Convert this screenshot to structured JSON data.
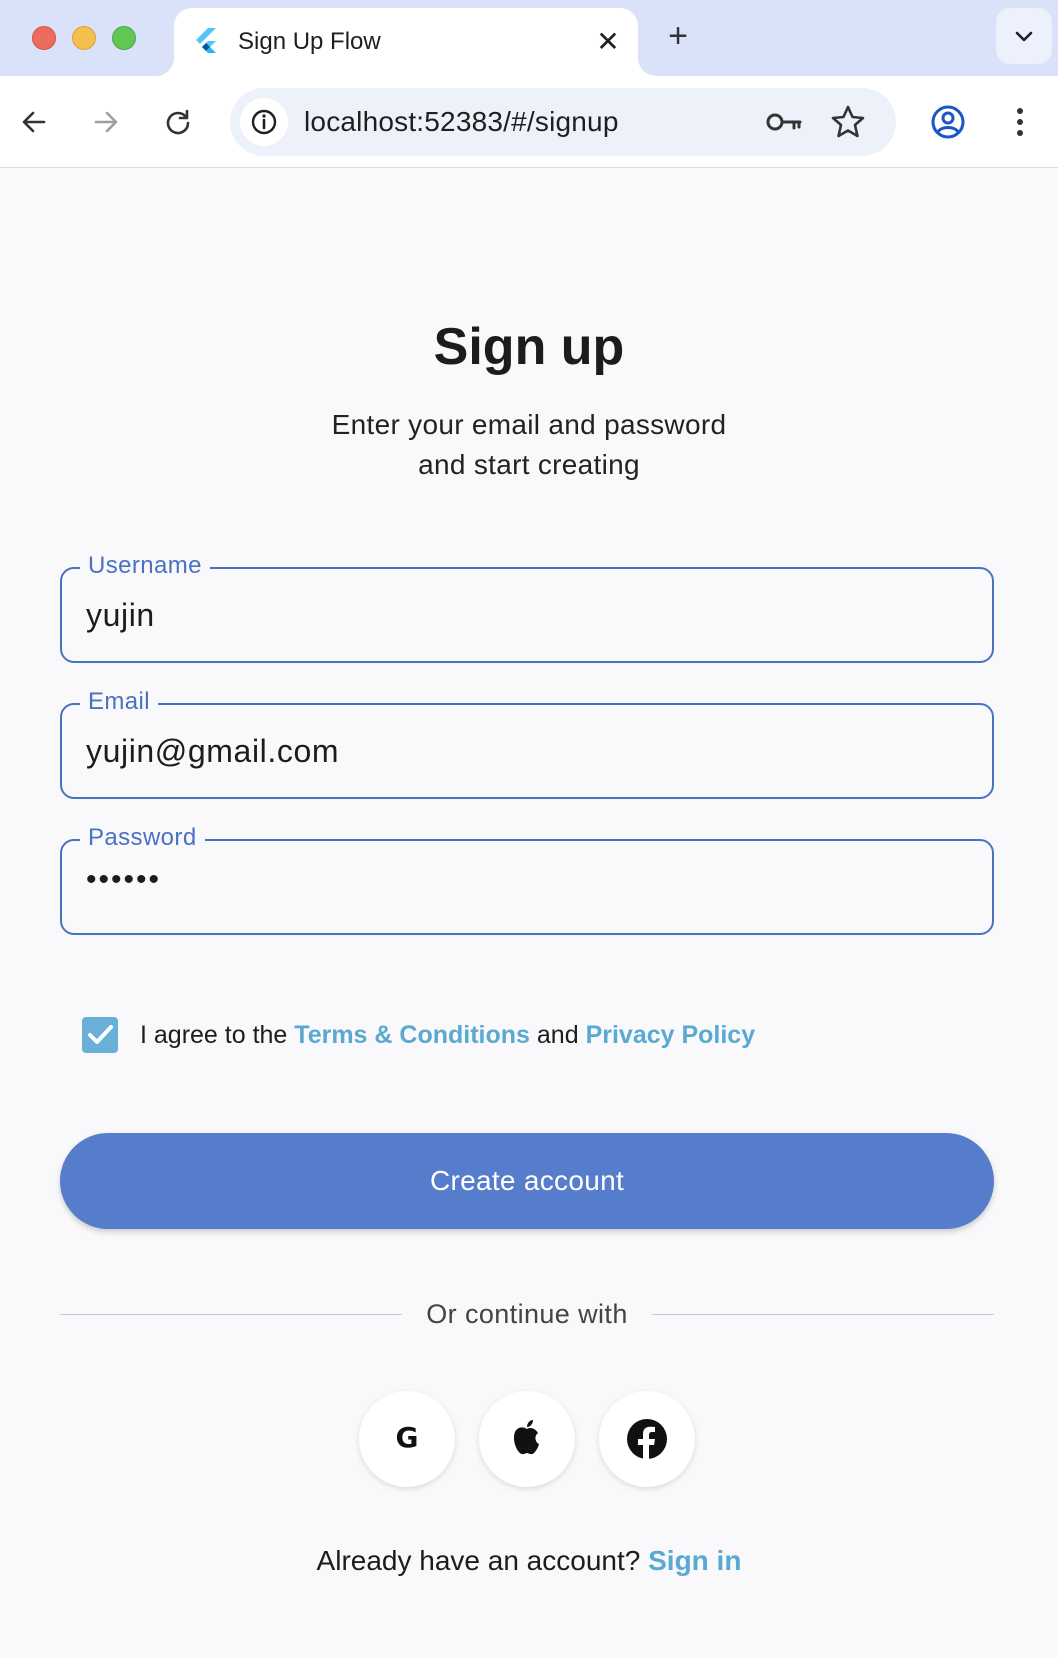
{
  "browser": {
    "tab_title": "Sign Up Flow",
    "tab_close": "✕",
    "new_tab": "+",
    "url": "localhost:52383/#/signup"
  },
  "signup": {
    "title": "Sign up",
    "subtitle_line1": "Enter your email and password",
    "subtitle_line2": "and start creating",
    "username_label": "Username",
    "username_value": "yujin",
    "email_label": "Email",
    "email_value": "yujin@gmail.com",
    "password_label": "Password",
    "password_value": "••••••",
    "agree_prefix": "I agree to the ",
    "terms_link": "Terms & Conditions",
    "agree_and": " and ",
    "privacy_link": "Privacy Policy",
    "agree_checked": true,
    "create_button": "Create account",
    "divider_text": "Or continue with",
    "google_letter": "G",
    "signin_prompt": "Already have an account? ",
    "signin_link": "Sign in"
  },
  "colors": {
    "accent": "#567dcb",
    "field_border": "#4a72c2",
    "link": "#5aa9d2",
    "checkbox": "#6aafd8",
    "tabstrip": "#d9e2f8"
  },
  "icons": {
    "social": [
      "google-icon",
      "apple-icon",
      "facebook-icon"
    ]
  }
}
